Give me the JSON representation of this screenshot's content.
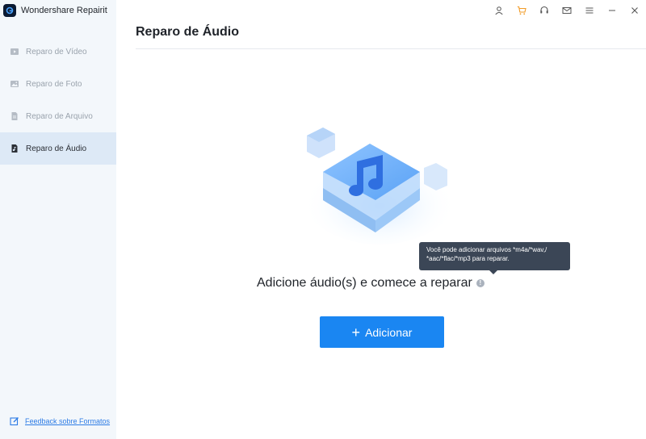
{
  "app": {
    "title": "Wondershare Repairit"
  },
  "sidebar": {
    "items": [
      {
        "label": "Reparo de Vídeo",
        "icon": "video-icon"
      },
      {
        "label": "Reparo de Foto",
        "icon": "photo-icon"
      },
      {
        "label": "Reparo de Arquivo",
        "icon": "file-icon"
      },
      {
        "label": "Reparo de Áudio",
        "icon": "audio-icon",
        "active": true
      }
    ],
    "feedback": "Feedback sobre Formatos"
  },
  "titlebar": {
    "icons": [
      "user-icon",
      "cart-icon",
      "headset-icon",
      "mail-icon",
      "menu-icon",
      "minimize-icon",
      "close-icon"
    ]
  },
  "main": {
    "title": "Reparo de Áudio",
    "headline": "Adicione áudio(s) e comece a reparar",
    "tooltip": {
      "line1": "Você pode adicionar arquivos *m4a/*wav,/",
      "line2": "*aac/*flac/*mp3 para reparar."
    },
    "add_button": "Adicionar"
  },
  "colors": {
    "accent": "#1a86f2",
    "sidebar_bg": "#f3f7fb",
    "active_bg": "#dde9f6",
    "tooltip_bg": "#3b4656"
  }
}
